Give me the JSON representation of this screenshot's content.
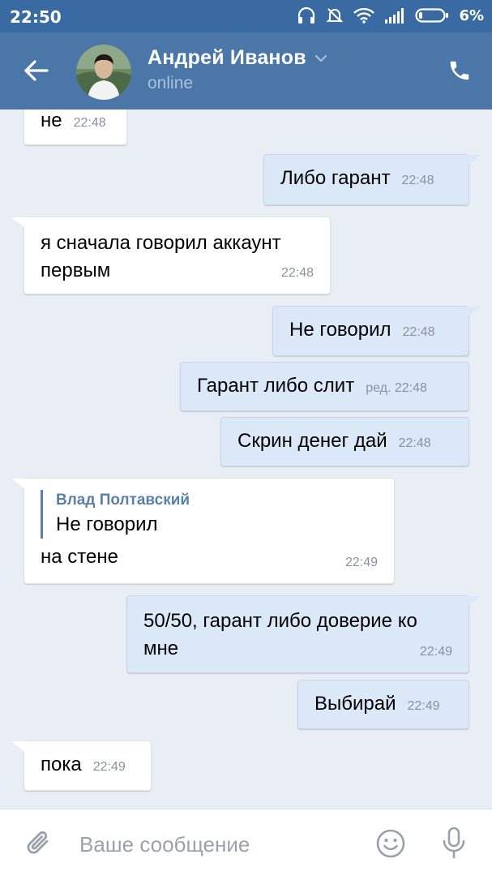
{
  "status_bar": {
    "time": "22:50",
    "battery_percent": "6%",
    "icons": [
      "headset-icon",
      "dnd-icon",
      "wifi-icon",
      "signal-icon",
      "battery-icon"
    ]
  },
  "header": {
    "contact_name": "Андрей Иванов",
    "status": "online",
    "icons": [
      "back-arrow-icon",
      "avatar",
      "chevron-down-icon",
      "phone-icon"
    ]
  },
  "messages": [
    {
      "direction": "in",
      "text": "не",
      "time": "22:48"
    },
    {
      "direction": "out",
      "text": "Либо гарант",
      "time": "22:48"
    },
    {
      "direction": "in",
      "text": "я сначала говорил аккаунт первым",
      "time": "22:48"
    },
    {
      "direction": "out",
      "text": "Не говорил",
      "time": "22:48"
    },
    {
      "direction": "out",
      "text": "Гарант либо слит",
      "time": "ред. 22:48"
    },
    {
      "direction": "out",
      "text": "Скрин денег дай",
      "time": "22:48"
    },
    {
      "direction": "in",
      "reply_author": "Влад Полтавский",
      "reply_text": "Не говорил",
      "text": "на стене",
      "time": "22:49"
    },
    {
      "direction": "out",
      "text": "50/50, гарант либо доверие ко мне",
      "time": "22:49"
    },
    {
      "direction": "out",
      "text": "Выбирай",
      "time": "22:49"
    },
    {
      "direction": "in",
      "text": "пока",
      "time": "22:49"
    }
  ],
  "composer": {
    "placeholder": "Ваше сообщение",
    "icons": [
      "paperclip-icon",
      "emoji-icon",
      "microphone-icon"
    ]
  },
  "colors": {
    "status_bar": "#3a6aa2",
    "header": "#4a76a8",
    "chat_background": "#e9eef4",
    "incoming_bubble": "#ffffff",
    "outgoing_bubble": "#dbe8f8",
    "accent": "#5b80a8"
  }
}
